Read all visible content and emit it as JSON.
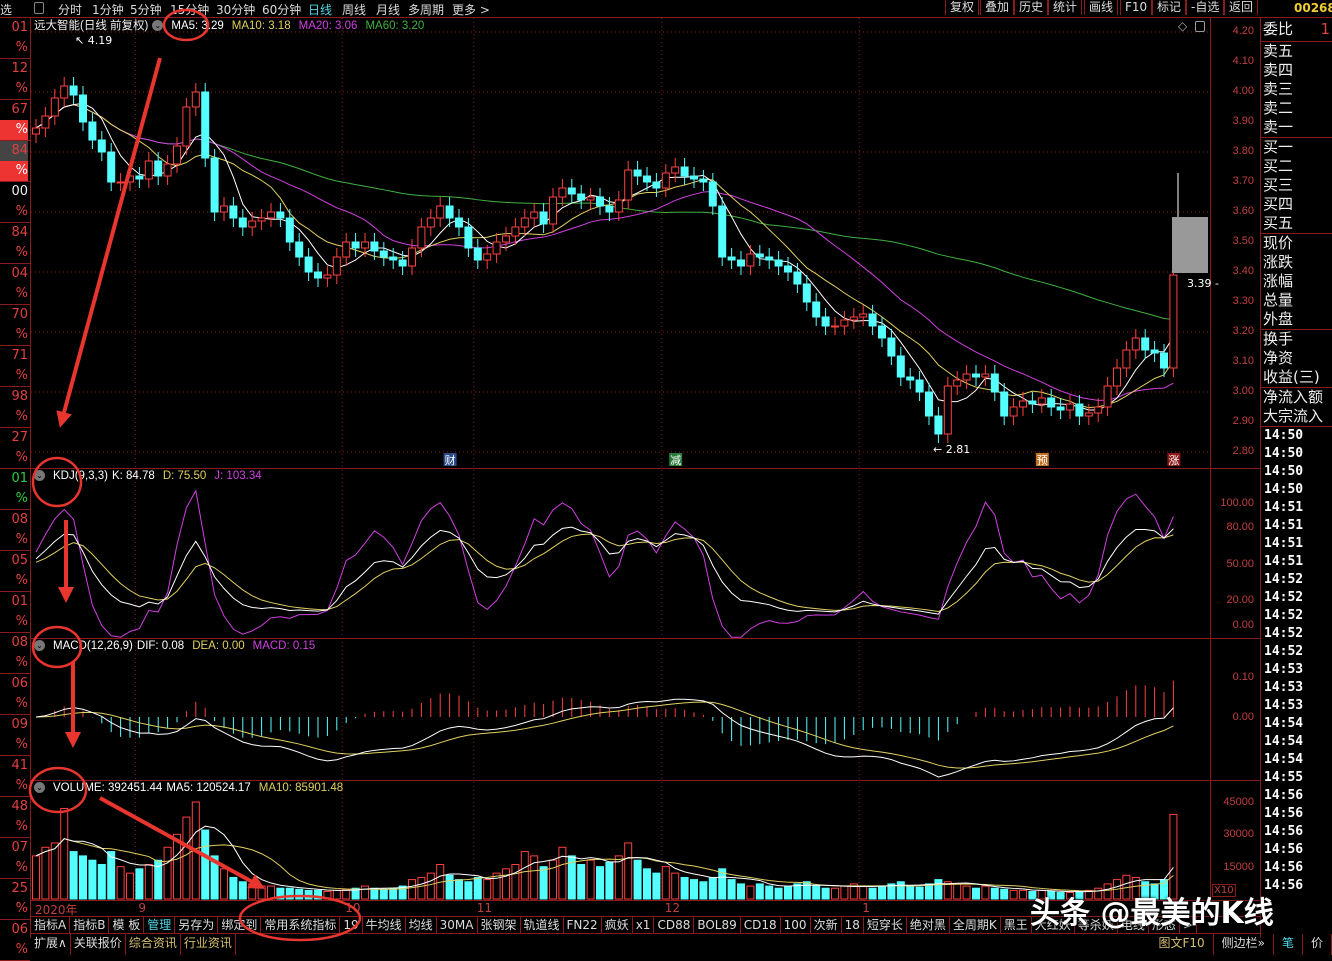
{
  "topbar": {
    "left_stub": "选",
    "tabs": [
      {
        "label": "分时",
        "active": false
      },
      {
        "label": "1分钟",
        "active": false
      },
      {
        "label": "5分钟",
        "active": false
      },
      {
        "label": "15分钟",
        "active": false
      },
      {
        "label": "30分钟",
        "active": false
      },
      {
        "label": "60分钟",
        "active": false
      },
      {
        "label": "日线",
        "active": true
      },
      {
        "label": "周线",
        "active": false
      },
      {
        "label": "月线",
        "active": false
      },
      {
        "label": "多周期",
        "active": false
      },
      {
        "label": "更多 >",
        "active": false
      }
    ],
    "buttons": [
      "复权",
      "叠加",
      "历史",
      "统计",
      "画线",
      "F10",
      "标记",
      "-自选",
      "返回"
    ],
    "stock_code": "00268"
  },
  "left_column": [
    {
      "num": "01",
      "pct": "%"
    },
    {
      "num": "12",
      "pct": "%"
    },
    {
      "num": "67",
      "pct": "%",
      "pct_highlight": true
    },
    {
      "num": "84",
      "pct": "%",
      "num_gray": true,
      "pct_highlight": true
    },
    {
      "num": "00",
      "pct": "%",
      "white": true
    },
    {
      "num": "84",
      "pct": "%"
    },
    {
      "num": "04",
      "pct": "%"
    },
    {
      "num": "70",
      "pct": "%"
    },
    {
      "num": "71",
      "pct": "%"
    },
    {
      "num": "98",
      "pct": "%"
    },
    {
      "num": "27",
      "pct": "%"
    },
    {
      "num": "01",
      "pct": "%",
      "green": true
    },
    {
      "num": "08",
      "pct": "%"
    },
    {
      "num": "05",
      "pct": "%"
    },
    {
      "num": "01",
      "pct": "%"
    },
    {
      "num": "08",
      "pct": "%"
    },
    {
      "num": "06",
      "pct": "%"
    },
    {
      "num": "09",
      "pct": "%"
    },
    {
      "num": "41",
      "pct": "%"
    },
    {
      "num": "48",
      "pct": "%"
    },
    {
      "num": "07",
      "pct": "%"
    },
    {
      "num": "25",
      "pct": "%"
    },
    {
      "num": "06",
      "pct": "%"
    }
  ],
  "main_chart": {
    "title": "远大智能(日线 前复权)",
    "ma5": "MA5: 3.29",
    "ma10": "MA10: 3.18",
    "ma20": "MA20: 3.06",
    "ma60": "MA60: 3.20",
    "high_label": "4.19",
    "low_label": "← 2.81",
    "last_label": "3.39 -",
    "events": [
      {
        "label": "财",
        "index": 44,
        "color": "#2a4a8a"
      },
      {
        "label": "减",
        "index": 68,
        "color": "#2a7a3a"
      },
      {
        "label": "预",
        "index": 107,
        "color": "#c07020"
      },
      {
        "label": "涨",
        "index": 121,
        "color": "#8a1a1a"
      }
    ]
  },
  "kdj": {
    "name": "KDJ(9,3,3)",
    "k": "K: 84.78",
    "d": "D: 75.50",
    "j": "J: 103.34"
  },
  "macd": {
    "name": "MACD(12,26,9)",
    "dif": "DIF: 0.08",
    "dea": "DEA: 0.00",
    "macd": "MACD: 0.15"
  },
  "volume": {
    "name": "VOLUME: 392451.44",
    "ma5": "MA5: 120524.17",
    "ma10": "MA10: 85901.48",
    "unit": "X10"
  },
  "dates": [
    {
      "label": "2020年",
      "index": 0
    },
    {
      "label": "9",
      "index": 11
    },
    {
      "label": "10",
      "index": 33
    },
    {
      "label": "11",
      "index": 47
    },
    {
      "label": "12",
      "index": 67
    },
    {
      "label": "1",
      "index": 88
    }
  ],
  "indicator_tabs": [
    {
      "label": "指标A"
    },
    {
      "label": "指标B"
    },
    {
      "label": "模 板"
    },
    {
      "label": "管理",
      "active": true
    },
    {
      "label": "另存为"
    },
    {
      "label": "绑定到"
    },
    {
      "label": "常用系统指标"
    },
    {
      "label": "19"
    },
    {
      "label": "牛均线"
    },
    {
      "label": "均线"
    },
    {
      "label": "30MA"
    },
    {
      "label": "张钢架"
    },
    {
      "label": "轨道线"
    },
    {
      "label": "FN22"
    },
    {
      "label": "疯妖"
    },
    {
      "label": "x1"
    },
    {
      "label": "CD88"
    },
    {
      "label": "BOL89"
    },
    {
      "label": "CD18"
    },
    {
      "label": "100"
    },
    {
      "label": "次新"
    },
    {
      "label": "18"
    },
    {
      "label": "短穿长"
    },
    {
      "label": "绝对黑"
    },
    {
      "label": "全周期K"
    },
    {
      "label": "黑王"
    },
    {
      "label": "大红妖"
    },
    {
      "label": "等杀妖"
    },
    {
      "label": "电线"
    },
    {
      "label": "形态"
    },
    {
      "label": ">"
    }
  ],
  "bottom_tabs": {
    "left": [
      {
        "label": "扩展∧"
      },
      {
        "label": "关联报价"
      },
      {
        "label": "综合资讯",
        "yellow": true
      },
      {
        "label": "行业资讯",
        "yellow": true
      }
    ],
    "right": [
      {
        "label": "图文F10",
        "yellow": true
      },
      {
        "label": "侧边栏»"
      },
      {
        "label": "笔",
        "cyan": true
      },
      {
        "label": "价"
      }
    ]
  },
  "right_panel": {
    "weibi": {
      "label": "委比",
      "value": "1"
    },
    "sell": [
      "卖五",
      "卖四",
      "卖三",
      "卖二",
      "卖一"
    ],
    "buy": [
      "买一",
      "买二",
      "买三",
      "买四",
      "买五"
    ],
    "quote": [
      "现价",
      "涨跌",
      "涨幅",
      "总量",
      "外盘"
    ],
    "misc": [
      "换手",
      "净资",
      "收益(三)"
    ],
    "flow": [
      "净流入额",
      "大宗流入"
    ],
    "times": [
      "14:50",
      "14:50",
      "14:50",
      "14:50",
      "14:51",
      "14:51",
      "14:51",
      "14:51",
      "14:52",
      "14:52",
      "14:52",
      "14:52",
      "14:52",
      "14:53",
      "14:53",
      "14:53",
      "14:54",
      "14:54",
      "14:54",
      "14:55",
      "14:56",
      "14:56",
      "14:56",
      "14:56",
      "14:56",
      "14:56"
    ]
  },
  "watermark": "头条 @最美的K线",
  "colors": {
    "up": "#ff4040",
    "down": "#54ffff",
    "ma5": "#ffffff",
    "ma10": "#e0d060",
    "ma20": "#d040e0",
    "ma60": "#40b040",
    "grid": "#8b1a1a"
  },
  "chart_data": {
    "type": "candlestick",
    "price_axis": {
      "ticks": [
        "4.20",
        "4.10",
        "4.00",
        "3.90",
        "3.80",
        "3.70",
        "3.60",
        "3.50",
        "3.40",
        "3.30",
        "3.20",
        "3.10",
        "3.00",
        "2.90",
        "2.80"
      ],
      "range": [
        2.8,
        4.2
      ]
    },
    "kdj_axis": [
      "100.00",
      "80.00",
      "50.00",
      "20.00",
      "0.00"
    ],
    "macd_axis": [
      "0.10",
      "0.00"
    ],
    "volume_axis": [
      "45000",
      "30000",
      "15000"
    ],
    "close": [
      3.88,
      3.92,
      3.98,
      4.02,
      3.99,
      3.9,
      3.84,
      3.8,
      3.7,
      3.7,
      3.72,
      3.71,
      3.77,
      3.72,
      3.76,
      3.82,
      3.95,
      4.0,
      3.78,
      3.6,
      3.62,
      3.58,
      3.55,
      3.57,
      3.58,
      3.6,
      3.58,
      3.5,
      3.45,
      3.4,
      3.38,
      3.39,
      3.45,
      3.5,
      3.48,
      3.5,
      3.47,
      3.45,
      3.44,
      3.42,
      3.48,
      3.55,
      3.58,
      3.62,
      3.58,
      3.55,
      3.48,
      3.44,
      3.46,
      3.5,
      3.52,
      3.55,
      3.58,
      3.6,
      3.56,
      3.65,
      3.68,
      3.66,
      3.64,
      3.65,
      3.62,
      3.6,
      3.64,
      3.74,
      3.72,
      3.7,
      3.68,
      3.73,
      3.75,
      3.72,
      3.71,
      3.7,
      3.62,
      3.45,
      3.44,
      3.42,
      3.46,
      3.45,
      3.44,
      3.42,
      3.4,
      3.36,
      3.3,
      3.25,
      3.22,
      3.22,
      3.24,
      3.25,
      3.26,
      3.22,
      3.18,
      3.12,
      3.05,
      3.04,
      3.0,
      2.92,
      2.86,
      3.02,
      3.04,
      3.06,
      3.05,
      3.06,
      3.0,
      2.92,
      2.95,
      2.97,
      2.96,
      2.98,
      2.95,
      2.94,
      2.96,
      2.92,
      2.93,
      2.95,
      3.02,
      3.08,
      3.14,
      3.18,
      3.14,
      3.13,
      3.08,
      3.39
    ],
    "volume": [
      20000,
      24000,
      26000,
      42000,
      22000,
      20000,
      18000,
      16000,
      22000,
      15000,
      12000,
      14000,
      16000,
      18000,
      24000,
      30000,
      38000,
      45000,
      32000,
      20000,
      14000,
      10000,
      8000,
      7000,
      6000,
      6000,
      5000,
      5000,
      4500,
      4000,
      4000,
      3500,
      4000,
      4500,
      5000,
      6000,
      5000,
      4500,
      5000,
      6000,
      9000,
      10000,
      12000,
      16000,
      11000,
      9000,
      8000,
      10000,
      9000,
      12000,
      14000,
      16000,
      22000,
      20000,
      15000,
      18000,
      24000,
      20000,
      16000,
      18000,
      15000,
      17000,
      20000,
      26000,
      18000,
      14000,
      12000,
      15000,
      12000,
      10000,
      9000,
      8000,
      10000,
      14000,
      9000,
      7000,
      6000,
      7000,
      6000,
      5000,
      6000,
      7000,
      8000,
      6000,
      5000,
      5000,
      6000,
      7000,
      6000,
      5000,
      6000,
      7000,
      8000,
      6000,
      5500,
      7000,
      9000,
      8000,
      7000,
      6000,
      5000,
      6000,
      5000,
      4500,
      4000,
      4000,
      3500,
      4000,
      3500,
      3000,
      3000,
      3500,
      4000,
      5000,
      7000,
      9000,
      11000,
      10000,
      8000,
      7000,
      9000,
      39245
    ]
  }
}
